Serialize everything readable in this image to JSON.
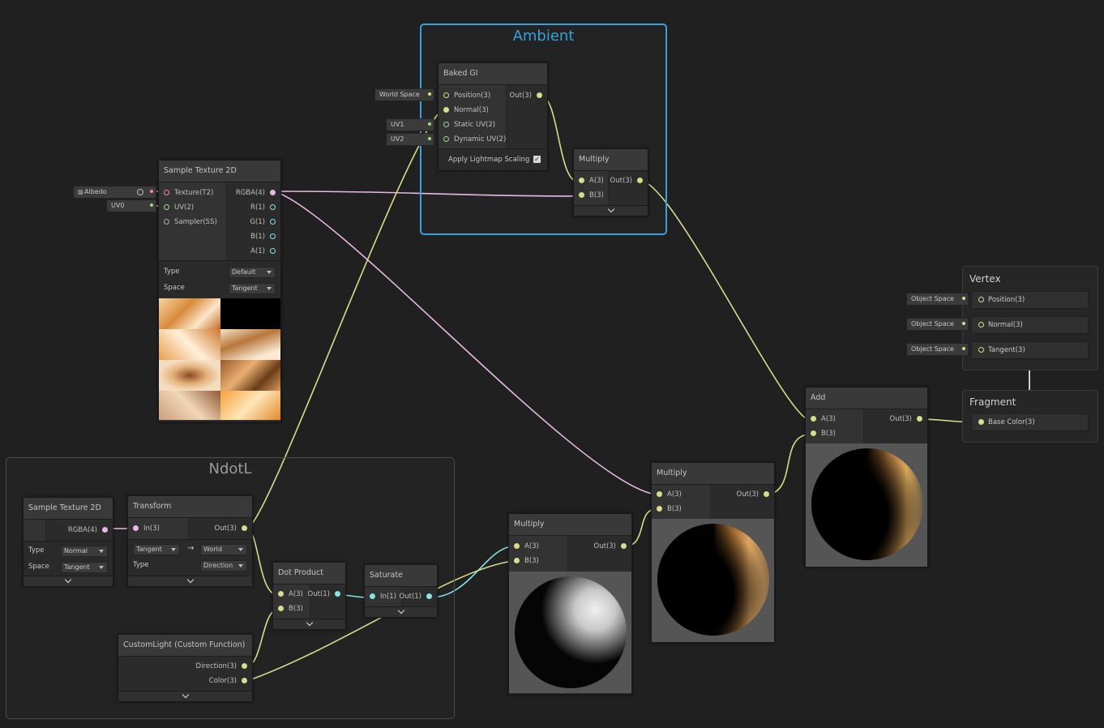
{
  "groups": {
    "ambient": {
      "title": "Ambient"
    },
    "ndotl": {
      "title": "NdotL"
    }
  },
  "baked_gi": {
    "title": "Baked GI",
    "inputs": [
      "Position(3)",
      "Normal(3)",
      "Static UV(2)",
      "Dynamic UV(2)"
    ],
    "output": "Out(3)",
    "option_label": "Apply Lightmap Scaling",
    "option_checked": true,
    "fields": {
      "position": "World Space",
      "static_uv": "UV1",
      "dynamic_uv": "UV2"
    }
  },
  "multiply_ambient": {
    "title": "Multiply",
    "inputs": [
      "A(3)",
      "B(3)"
    ],
    "output": "Out(3)"
  },
  "sample_texture_main": {
    "title": "Sample Texture 2D",
    "inputs": [
      "Texture(T2)",
      "UV(2)",
      "Sampler(SS)"
    ],
    "outputs": [
      "RGBA(4)",
      "R(1)",
      "G(1)",
      "B(1)",
      "A(1)"
    ],
    "props": [
      {
        "label": "Type",
        "value": "Default"
      },
      {
        "label": "Space",
        "value": "Tangent"
      }
    ],
    "fields": {
      "texture": "Albedo",
      "uv": "UV0"
    }
  },
  "vertex": {
    "title": "Vertex",
    "slots": [
      "Position(3)",
      "Normal(3)",
      "Tangent(3)"
    ],
    "space_label": "Object Space"
  },
  "fragment": {
    "title": "Fragment",
    "slots": [
      "Base Color(3)"
    ]
  },
  "add": {
    "title": "Add",
    "inputs": [
      "A(3)",
      "B(3)"
    ],
    "output": "Out(3)"
  },
  "multiply_mid": {
    "title": "Multiply",
    "inputs": [
      "A(3)",
      "B(3)"
    ],
    "output": "Out(3)"
  },
  "multiply_low": {
    "title": "Multiply",
    "inputs": [
      "A(3)",
      "B(3)"
    ],
    "output": "Out(3)"
  },
  "sample_texture_normal": {
    "title": "Sample Texture 2D",
    "output": "RGBA(4)",
    "props": [
      {
        "label": "Type",
        "value": "Normal"
      },
      {
        "label": "Space",
        "value": "Tangent"
      }
    ]
  },
  "transform": {
    "title": "Transform",
    "input": "In(3)",
    "output": "Out(3)",
    "from": "Tangent",
    "to": "World",
    "type_label": "Type",
    "type_value": "Direction"
  },
  "dot_product": {
    "title": "Dot Product",
    "inputs": [
      "A(3)",
      "B(3)"
    ],
    "output": "Out(1)"
  },
  "saturate": {
    "title": "Saturate",
    "input": "In(1)",
    "output": "Out(1)"
  },
  "custom_light": {
    "title": "CustomLight (Custom Function)",
    "outputs": [
      "Direction(3)",
      "Color(3)"
    ]
  },
  "colors": {
    "wire_vec3": "#d8dd8a",
    "wire_vec4": "#e9b6e6",
    "wire_float": "#84e4e7",
    "selection": "#3aa0dc"
  }
}
